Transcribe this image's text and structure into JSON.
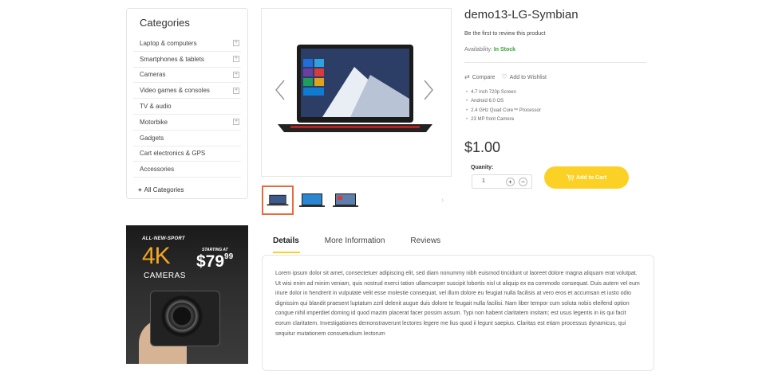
{
  "sidebar": {
    "title": "Categories",
    "items": [
      {
        "label": "Laptop & computers",
        "expandable": true
      },
      {
        "label": "Smartphones & tablets",
        "expandable": true
      },
      {
        "label": "Cameras",
        "expandable": true
      },
      {
        "label": "Video games & consoles",
        "expandable": true
      },
      {
        "label": "TV & audio",
        "expandable": false
      },
      {
        "label": "Motorbike",
        "expandable": true
      },
      {
        "label": "Gadgets",
        "expandable": false
      },
      {
        "label": "Cart electronics & GPS",
        "expandable": false
      },
      {
        "label": "Accessories",
        "expandable": false
      }
    ],
    "all_categories": "All Categories"
  },
  "banner": {
    "tagline": "ALL-NEW-SPORT",
    "headline": "4K",
    "subhead": "CAMERAS",
    "starting_at": "STARTING AT",
    "price": "$79",
    "price_cents": "99"
  },
  "product": {
    "title": "demo13-LG-Symbian",
    "review_prompt": "Be the first to review this product",
    "availability_label": "Availability:",
    "availability_value": "In Stock",
    "compare_label": "Compare",
    "wishlist_label": "Add to Wishlist",
    "features": [
      "4.7 inch 720p Screen",
      "Android 6.0 OS",
      "2.4 GHz Quad Core™ Processor",
      "23 MP front Camera"
    ],
    "price": "$1.00",
    "quantity_label": "Quanity:",
    "quantity_value": "1",
    "add_to_cart": "Add to Cart",
    "thumbnail_count": 3,
    "selected_thumbnail": 1
  },
  "tabs": {
    "items": [
      "Details",
      "More Information",
      "Reviews"
    ],
    "active": "Details",
    "details_text": "Lorem ipsum dolor sit amet, consectetuer adipiscing elit, sed diam nonummy nibh euismod tincidunt ut laoreet dolore magna aliquam erat volutpat. Ut wisi enim ad minim veniam, quis nostrud exerci tation ullamcorper suscipit lobortis nisl ut aliquip ex ea commodo consequat. Duis autem vel eum iriure dolor in hendrerit in vulputate velit esse molestie consequat, vel illum dolore eu feugiat nulla facilisis at vero eros et accumsan et iusto odio dignissim qui blandit praesent luptatum zzril delenit augue duis dolore te feugait nulla facilisi. Nam liber tempor cum soluta nobis eleifend option congue nihil imperdiet doming id quod mazim placerat facer possim assum. Typi non habent claritatem insitam; est usus legentis in iis qui facit eorum claritatem. Investigationes demonstraverunt lectores legere me lius quod ii legunt saepius. Claritas est etiam processus dynamicus, qui sequitur mutationem consuetudium lectorum"
  },
  "colors": {
    "accent_yellow": "#fcd125",
    "in_stock_green": "#3aa53a",
    "thumb_active": "#e86a3a",
    "banner_orange": "#f5a623"
  }
}
